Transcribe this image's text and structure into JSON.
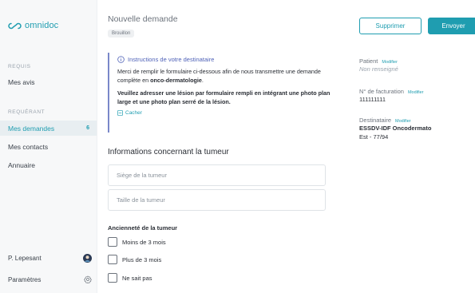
{
  "app": {
    "logo_text": "omnidoc"
  },
  "sidebar": {
    "section_requis": "REQUIS",
    "mes_avis": "Mes avis",
    "section_requerant": "REQUÉRANT",
    "mes_demandes": "Mes demandes",
    "mes_demandes_count": "6",
    "mes_contacts": "Mes contacts",
    "annuaire": "Annuaire",
    "user_name": "P. Lepesant",
    "parametres": "Paramètres"
  },
  "main": {
    "title": "Nouvelle demande",
    "status_badge": "Brouillon",
    "info": {
      "heading": "Instructions de votre destinataire",
      "p1_prefix": "Merci de remplir le formulaire ci-dessous afin de nous transmettre une demande complète en ",
      "p1_bold": "onco-dermatologie",
      "p1_suffix": ".",
      "p2": "Veuillez adresser une lésion par formulaire rempli en intégrant une photo plan large et une photo plan serré de la lésion.",
      "hide_label": "Cacher"
    },
    "section_title": "Informations concernant la tumeur",
    "fields": {
      "siege_placeholder": "Siège de la tumeur",
      "taille_placeholder": "Taille de la tumeur"
    },
    "anciennete": {
      "label": "Ancienneté de la tumeur",
      "options": [
        "Moins de 3 mois",
        "Plus de 3 mois",
        "Ne sait pas"
      ]
    }
  },
  "right_panel": {
    "delete_label": "Supprimer",
    "send_label": "Envoyer",
    "modify_label": "Modifier",
    "patient_label": "Patient",
    "patient_value": "Non renseigné",
    "billing_label": "N° de facturation",
    "billing_value": "111111111",
    "recipient_label": "Destinataire",
    "recipient_value": "ESSDV-IDF Oncodermato",
    "recipient_sub": "Est - 77/94"
  },
  "colors": {
    "accent": "#1f9db0",
    "info": "#4f62b8"
  }
}
